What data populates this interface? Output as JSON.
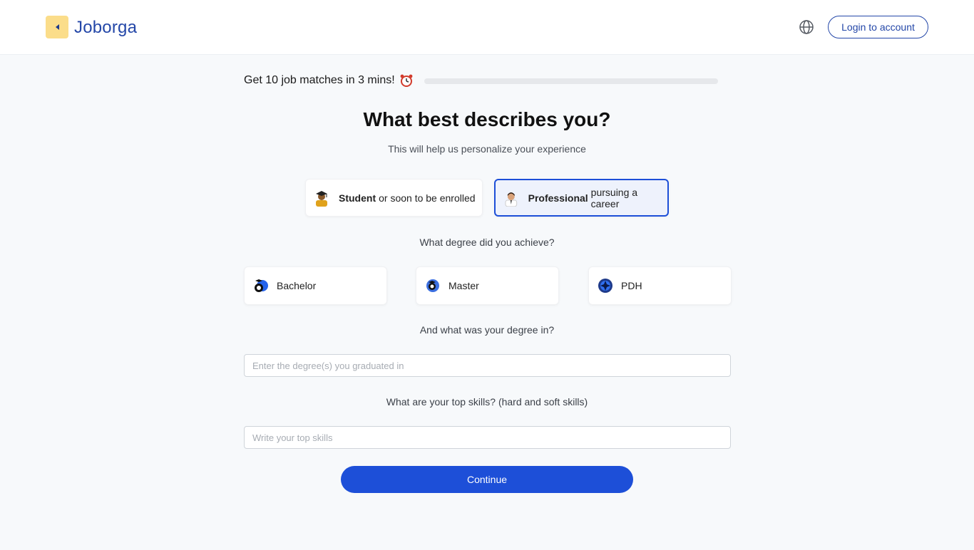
{
  "header": {
    "brand": "Joborga",
    "logo_icon": "play-reverse-icon",
    "language_icon": "globe-icon",
    "login_label": "Login to account"
  },
  "progress": {
    "text": "Get 10 job matches in 3 mins!",
    "emoji_icon": "alarm-clock-icon",
    "fraction": 0.0
  },
  "main": {
    "title": "What best describes you?",
    "subtitle": "This will help us personalize your experience",
    "roles": [
      {
        "bold": "Student",
        "rest": "or soon to be enrolled",
        "icon": "student-avatar-icon",
        "selected": false
      },
      {
        "bold": "Professional",
        "rest": "pursuing a career",
        "icon": "professional-avatar-icon",
        "selected": true
      }
    ],
    "degree_question": "What degree did you achieve?",
    "degrees": [
      {
        "label": "Bachelor",
        "icon": "bachelor-icon"
      },
      {
        "label": "Master",
        "icon": "master-icon"
      },
      {
        "label": "PDH",
        "icon": "phd-icon"
      }
    ],
    "degree_field_question": "And what was your degree in?",
    "degree_field_placeholder": "Enter the degree(s) you graduated in",
    "degree_field_value": "",
    "skills_question": "What are your top skills? (hard and soft skills)",
    "skills_placeholder": "Write your top skills",
    "skills_value": "",
    "continue_label": "Continue"
  },
  "colors": {
    "accent": "#1d4fd8",
    "brand": "#2447a8",
    "logo_bg": "#fbdd8a",
    "background": "#f7f9fb"
  }
}
